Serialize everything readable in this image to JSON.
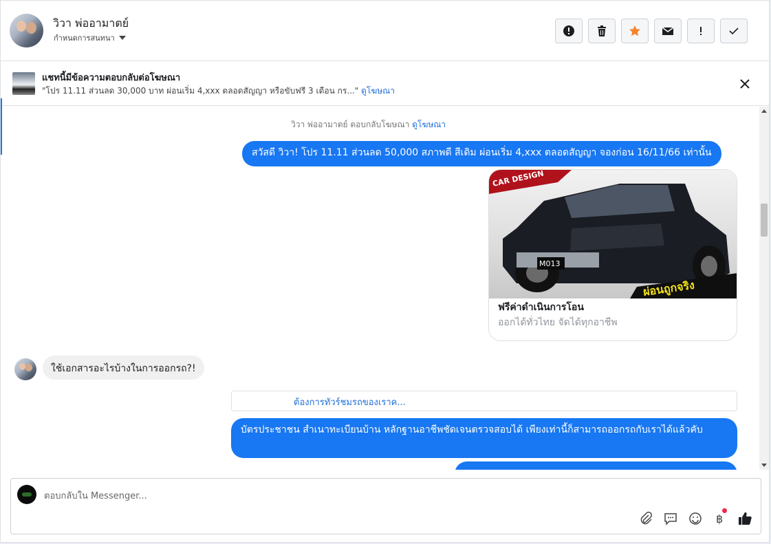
{
  "header": {
    "contact_name": "วิวา พ่ออามาตย์",
    "conversation_label": "กำหนดการสนทนา",
    "actions": [
      {
        "name": "report-spam-icon",
        "icon": "exclamation-circle"
      },
      {
        "name": "delete-icon",
        "icon": "trash"
      },
      {
        "name": "star-icon",
        "icon": "star",
        "color": "#f6832a"
      },
      {
        "name": "mark-unread-icon",
        "icon": "envelope"
      },
      {
        "name": "flag-important-icon",
        "icon": "exclamation"
      },
      {
        "name": "mark-done-icon",
        "icon": "check"
      }
    ]
  },
  "ad_banner": {
    "title": "แชทนี้มีข้อความตอบกลับต่อโฆษณา",
    "quote": "\"โปร 11.11 ส่วนลด 30,000 บาท ผ่อนเริ่ม 4,xxx ตลอดสัญญา หรือขับฟรี 3 เดือน กร...\"",
    "link": "ดูโฆษณา"
  },
  "thread": {
    "reply_note": "วิวา พ่ออามาตย์ ตอบกลับโฆษณา",
    "reply_note_link": "ดูโฆษณา",
    "message_1": "สวัสดี วิวา! โปร 11.11 ส่วนลด 50,000 สภาพดี สีเดิม ผ่อนเริ่ม 4,xxx ตลอดสัญญา จองก่อน 16/11/66 เท่านั้น",
    "card": {
      "badge": "CAR DESIGN",
      "plate": "M013",
      "overlay": "ผ่อนถูกจริง",
      "title": "ฟรีค่าดำเนินการโอน",
      "subtitle": "ออกได้ทั่วไทย จัดได้ทุกอาชีพ"
    },
    "incoming": "ใช้เอกสารอะไรบ้างในการออกรถ?!",
    "quick_reply": "ต้องการทัวร์ชมรถของเราค...",
    "message_2": "บัตรประชาชน สำเนาทะเบียนบ้าน หลักฐานอาชีพชัดเจนตรวจสอบได้ เพียงเท่านี้ก็สามารถออกรถกับเราได้แล้วคับ",
    "message_3": ""
  },
  "composer": {
    "placeholder": "ตอบกลับใน Messenger...",
    "tools": [
      "paperclip-icon",
      "saved-reply-icon",
      "emoji-icon",
      "baht-icon",
      "like-icon"
    ]
  },
  "colors": {
    "accent": "#1877f2",
    "link": "#216fdb",
    "star": "#f6832a"
  }
}
